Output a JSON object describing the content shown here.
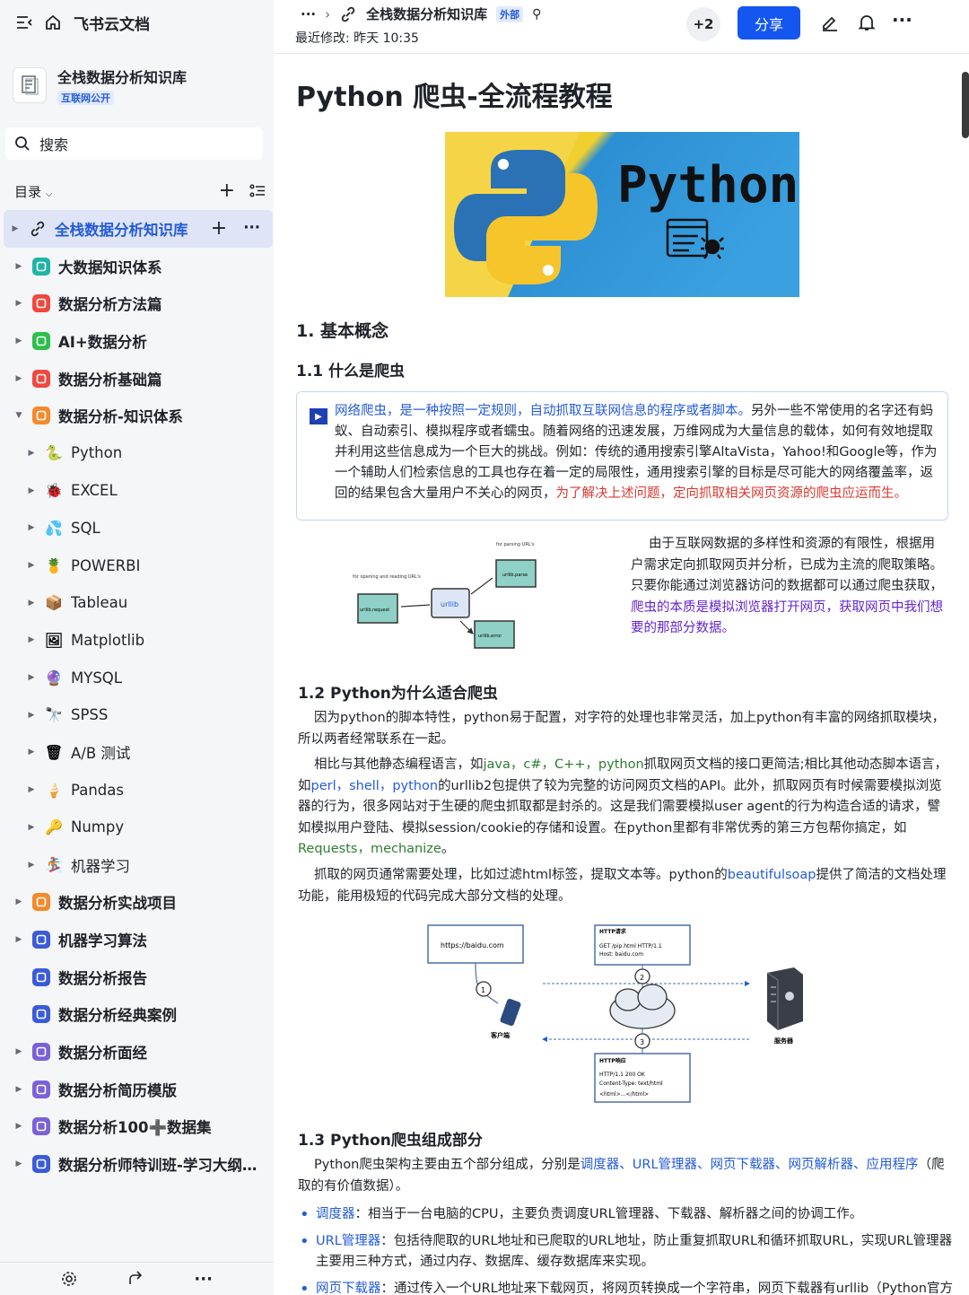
{
  "app": {
    "name": "飞书云文档"
  },
  "knowledge_base": {
    "title": "全栈数据分析知识库",
    "badge": "互联网公开"
  },
  "search": {
    "label": "搜索"
  },
  "toc": {
    "label": "目录"
  },
  "tree": [
    {
      "label": "全栈数据分析知识库",
      "active": true,
      "icon": "link-icon"
    },
    {
      "label": "大数据知识体系",
      "color": "#1fb4a8"
    },
    {
      "label": "数据分析方法篇",
      "color": "#f0483e"
    },
    {
      "label": "AI+数据分析",
      "color": "#2bbf4b"
    },
    {
      "label": "数据分析基础篇",
      "color": "#f0483e"
    },
    {
      "label": "数据分析-知识体系",
      "color": "#f58a2b",
      "expanded": true
    },
    {
      "label": "Python",
      "child": true,
      "emoji": "🐍"
    },
    {
      "label": "EXCEL",
      "child": true,
      "emoji": "🐞"
    },
    {
      "label": "SQL",
      "child": true,
      "emoji": "💦"
    },
    {
      "label": "POWERBI",
      "child": true,
      "emoji": "🍍"
    },
    {
      "label": "Tableau",
      "child": true,
      "emoji": "📦"
    },
    {
      "label": "Matplotlib",
      "child": true,
      "emoji": "🖼"
    },
    {
      "label": "MYSQL",
      "child": true,
      "emoji": "🔮"
    },
    {
      "label": "SPSS",
      "child": true,
      "emoji": "🔭"
    },
    {
      "label": "A/B 测试",
      "child": true,
      "emoji": "🗑"
    },
    {
      "label": "Pandas",
      "child": true,
      "emoji": "🍦"
    },
    {
      "label": "Numpy",
      "child": true,
      "emoji": "🔑"
    },
    {
      "label": "机器学习",
      "child": true,
      "emoji": "🏂"
    },
    {
      "label": "数据分析实战项目",
      "color": "#f58a2b"
    },
    {
      "label": "机器学习算法",
      "color": "#3b5bdb"
    },
    {
      "label": "数据分析报告",
      "color": "#3b5bdb",
      "nocaret": true
    },
    {
      "label": "数据分析经典案例",
      "color": "#3b5bdb",
      "nocaret": true
    },
    {
      "label": "数据分析面经",
      "color": "#7b61d9"
    },
    {
      "label": "数据分析简历模版",
      "color": "#7b61d9"
    },
    {
      "label": "数据分析100➕数据集",
      "color": "#7b61d9"
    },
    {
      "label": "数据分析师特训班-学习大纲（...",
      "color": "#3b5bdb"
    }
  ],
  "header": {
    "breadcrumb_doc": "全栈数据分析知识库",
    "tag": "外部",
    "last_modified": "最近修改: 昨天 10:35",
    "collaborators": "+2",
    "share_label": "分享"
  },
  "doc": {
    "title": "Python 爬虫-全流程教程",
    "banner_text": "Python",
    "h_basic": "1. 基本概念",
    "h_what": "1.1 什么是爬虫",
    "callout_intro": "网络爬虫，是一种按照一定规则，自动抓取互联网信息的程序或者脚本。",
    "callout_body": "另外一些不常使用的名字还有蚂蚁、自动索引、模拟程序或者蠕虫。随着网络的迅速发展，万维网成为大量信息的载体，如何有效地提取并利用这些信息成为一个巨大的挑战。例如：传统的通用搜索引擎AltaVista，Yahoo!和Google等，作为一个辅助人们检索信息的工具也存在着一定的局限性，通用搜索引擎的目标是尽可能大的网络覆盖率，返回的结果包含大量用户不关心的网页，",
    "callout_end": "为了解决上述问题，定向抓取相关网页资源的爬虫应运而生。",
    "side_text": "由于互联网数据的多样性和资源的有限性，根据用户需求定向抓取网页并分析，已成为主流的爬取策略。只要你能通过浏览器访问的数据都可以通过爬虫获取，",
    "side_text_link": "爬虫的本质是模拟浏览器打开网页，获取网页中我们想要的那部分数据。",
    "diagram1": {
      "parsing": "for parsing URL's",
      "opening": "for opening and reading URL's",
      "parse": "urllib.parse",
      "urllib": "urllib",
      "request": "urllib.request",
      "error": "urllib.error"
    },
    "h_why": "1.2 Python为什么适合爬虫",
    "why_p1": "因为python的脚本特性，python易于配置，对字符的处理也非常灵活，加上python有丰富的网络抓取模块，所以两者经常联系在一起。",
    "why_p2_a": "相比与其他静态编程语言，如",
    "why_p2_langs": "java，c#，C++，python",
    "why_p2_b": "抓取网页文档的接口更简洁;相比其他动态脚本语言，如",
    "why_p2_langs2": "perl，shell，python",
    "why_p2_c": "的urllib2包提供了较为完整的访问网页文档的API。此外，抓取网页有时候需要模拟浏览器的行为，很多网站对于生硬的爬虫抓取都是封杀的。这是我们需要模拟user agent的行为构造合适的请求，譬如模拟用户登陆、模拟session/cookie的存储和设置。在python里都有非常优秀的第三方包帮你搞定，如",
    "why_p2_pkgs": "Requests，mechanize",
    "why_p3_a": "抓取的网页通常需要处理，比如过滤html标签，提取文本等。python的",
    "why_p3_pkg": "beautifulsoap",
    "why_p3_b": "提供了简洁的文档处理功能，能用极短的代码完成大部分文档的处理。",
    "diagram2": {
      "url": "https://baidu.com",
      "req_title": "HTTP请求",
      "req_line1": "GET /pip.html HTTP/1.1",
      "req_line2": "Host: baidu.com",
      "resp_title": "HTTP响应",
      "resp_line1": "HTTP/1.1 200 OK",
      "resp_line2": "Content-Type: text/html",
      "resp_line3": "<html>...</html>",
      "client": "客户端",
      "server": "服务器",
      "n1": "1",
      "n2": "2",
      "n3": "3"
    },
    "h_parts": "1.3 Python爬虫组成部分",
    "parts_a": "Python爬虫架构主要由五个部分组成，分别是",
    "parts_list": "调度器、URL管理器、网页下载器、网页解析器、应用程序",
    "parts_b": "（爬取的有价值数据）。",
    "bullets": [
      {
        "term": "调度器",
        "text": "：相当于一台电脑的CPU，主要负责调度URL管理器、下载器、解析器之间的协调工作。"
      },
      {
        "term": "URL管理器",
        "text": "：包括待爬取的URL地址和已爬取的URL地址，防止重复抓取URL和循环抓取URL，实现URL管理器主要用三种方式，通过内存、数据库、缓存数据库来实现。"
      },
      {
        "term": "网页下载器",
        "text": "：通过传入一个URL地址来下载网页，将网页转换成一个字符串，网页下载器有urllib（Python官方"
      }
    ]
  },
  "colors": {
    "accent": "#245bdb",
    "share": "#1456f0",
    "sidebar_bg": "#f5f6f7"
  }
}
